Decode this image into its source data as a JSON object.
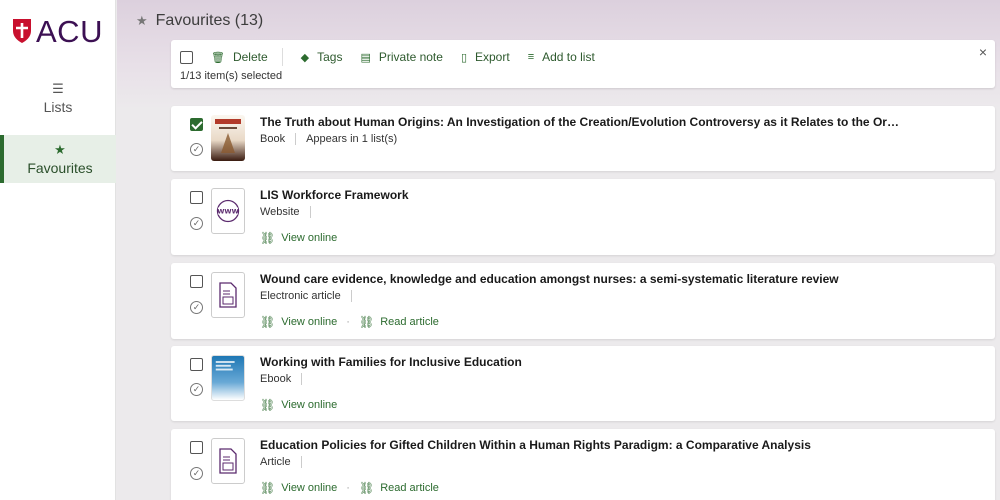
{
  "brand": {
    "name": "ACU",
    "accent": "#2c6b2f",
    "logo_color": "#3c1053",
    "shield_color": "#c8102e"
  },
  "sidebar": {
    "items": [
      {
        "label": "Lists",
        "icon": "list-icon",
        "active": false
      },
      {
        "label": "Favourites",
        "icon": "star-icon",
        "active": true
      }
    ]
  },
  "header": {
    "title": "Favourites (13)"
  },
  "toolbar": {
    "delete": "Delete",
    "tags": "Tags",
    "private_note": "Private note",
    "export": "Export",
    "add_to_list": "Add to list",
    "selected": "1/13 item(s) selected",
    "close": "×"
  },
  "items": [
    {
      "title": "The Truth about Human Origins: An Investigation of the Creation/Evolution Controversy as it Relates to the Or…",
      "type": "Book",
      "extra": "Appears in 1 list(s)",
      "checked": true,
      "thumb": "book-cover"
    },
    {
      "title": "LIS Workforce Framework",
      "type": "Website",
      "checked": false,
      "thumb": "www-icon",
      "links": {
        "view_online": "View online"
      }
    },
    {
      "title": "Wound care evidence, knowledge and education amongst nurses: a semi-systematic literature review",
      "type": "Electronic article",
      "checked": false,
      "thumb": "document-icon",
      "links": {
        "view_online": "View online",
        "read_article": "Read article"
      }
    },
    {
      "title": "Working with Families for Inclusive Education",
      "type": "Ebook",
      "checked": false,
      "thumb": "ebook-cover",
      "links": {
        "view_online": "View online"
      }
    },
    {
      "title": "Education Policies for Gifted Children Within a Human Rights Paradigm: a Comparative Analysis",
      "type": "Article",
      "checked": false,
      "thumb": "document-icon",
      "links": {
        "view_online": "View online",
        "read_article": "Read article"
      }
    }
  ]
}
